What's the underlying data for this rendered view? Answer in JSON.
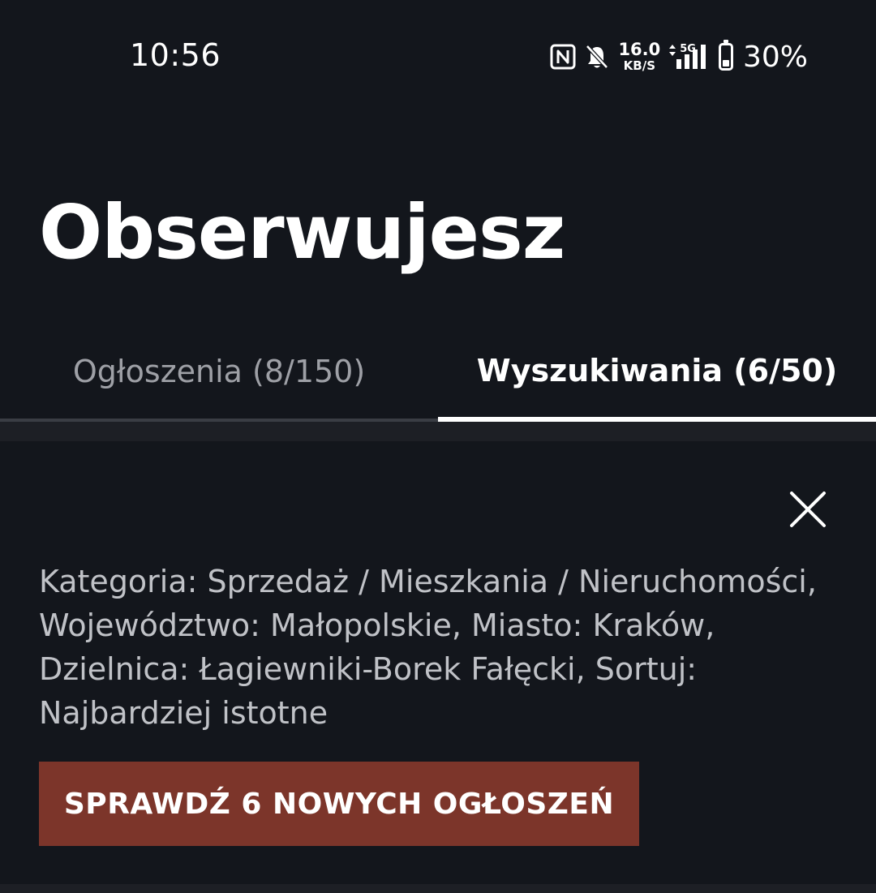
{
  "status_bar": {
    "time": "10:56",
    "net_speed_value": "16.0",
    "net_speed_unit": "KB/S",
    "network_type": "5G",
    "battery_percent": "30%",
    "battery_level": 0.3,
    "icons": [
      "nfc-icon",
      "bell-muted-icon",
      "data-arrows-icon",
      "signal-icon",
      "battery-icon"
    ]
  },
  "header": {
    "title": "Obserwujesz"
  },
  "tabs": [
    {
      "label": "Ogłoszenia (8/150)",
      "active": false
    },
    {
      "label": "Wyszukiwania (6/50)",
      "active": true
    }
  ],
  "saved_search": {
    "description": "Kategoria: Sprzedaż / Mieszkania / Nieruchomości, Województwo: Małopolskie, Miasto: Kraków, Dzielnica: Łagiewniki-Borek Fałęcki, Sortuj: Najbardziej istotne",
    "button_label": "SPRAWDŹ 6 NOWYCH OGŁOSZEŃ",
    "close_icon": "close-icon"
  },
  "colors": {
    "background": "#13161c",
    "button": "#7c352a",
    "active_tab_indicator": "#ffffff",
    "inactive_tab_text": "#9ea0a6"
  }
}
